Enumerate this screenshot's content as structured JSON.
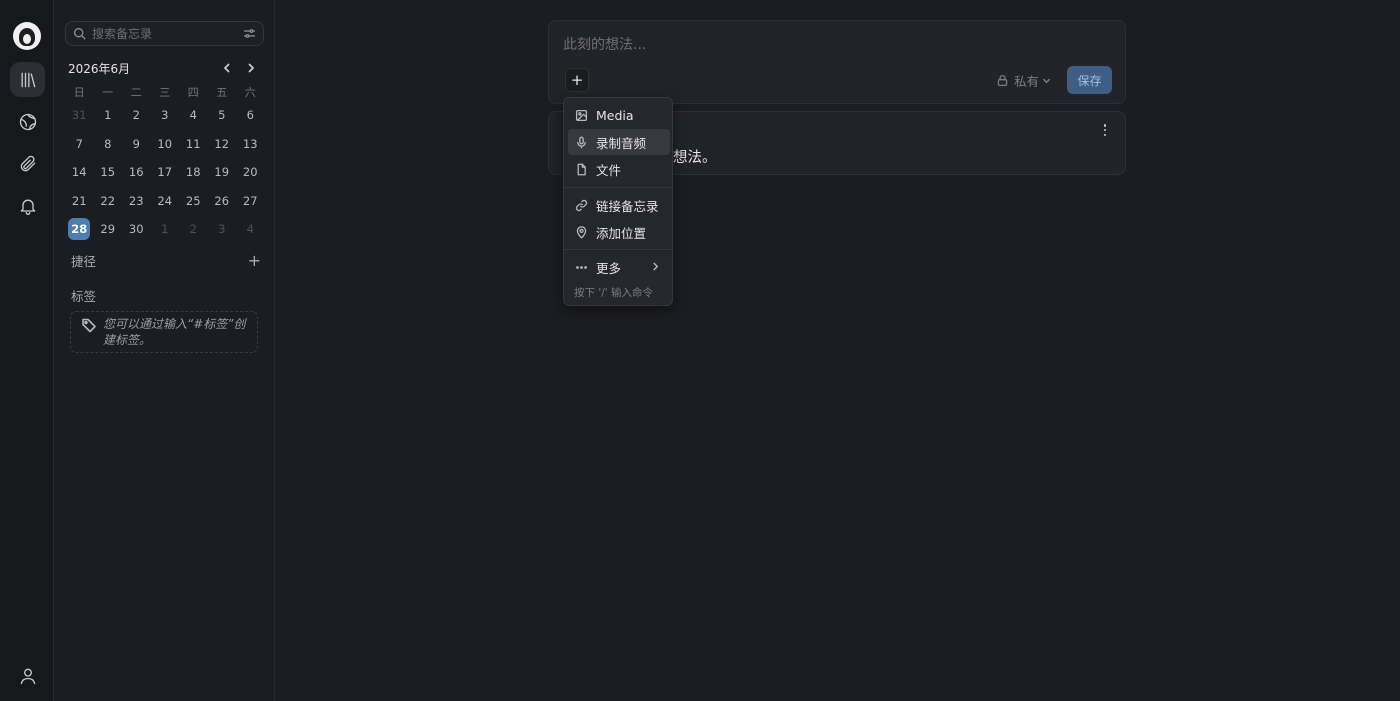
{
  "sidebar": {
    "search_placeholder": "搜索备忘录",
    "calendar": {
      "title": "2026年6月",
      "weekdays": [
        "日",
        "一",
        "二",
        "三",
        "四",
        "五",
        "六"
      ],
      "weeks": [
        [
          "31",
          "1",
          "2",
          "3",
          "4",
          "5",
          "6"
        ],
        [
          "7",
          "8",
          "9",
          "10",
          "11",
          "12",
          "13"
        ],
        [
          "14",
          "15",
          "16",
          "17",
          "18",
          "19",
          "20"
        ],
        [
          "21",
          "22",
          "23",
          "24",
          "25",
          "26",
          "27"
        ],
        [
          "28",
          "29",
          "30",
          "1",
          "2",
          "3",
          "4"
        ]
      ],
      "today": "28"
    },
    "shortcuts_label": "捷径",
    "add_symbol": "+",
    "tags_label": "标签",
    "tags_hint": "您可以通过输入“#标签”创建标签。"
  },
  "editor": {
    "placeholder": "此刻的想法...",
    "add_symbol": "+",
    "visibility": "私有",
    "save_label": "保存"
  },
  "memo": {
    "visible_text": "想法。"
  },
  "menu": {
    "items": [
      {
        "label": "Media",
        "icon": "image-icon"
      },
      {
        "label": "录制音频",
        "icon": "microphone-icon"
      },
      {
        "label": "文件",
        "icon": "file-icon"
      },
      {
        "label": "链接备忘录",
        "icon": "link-icon"
      },
      {
        "label": "添加位置",
        "icon": "map-pin-icon"
      },
      {
        "label": "更多",
        "icon": "ellipsis-icon"
      }
    ],
    "hint": "按下 '/' 输入命令"
  },
  "colors": {
    "accent": "#4e7db1",
    "background": "#1c1d22",
    "card": "#222328"
  }
}
